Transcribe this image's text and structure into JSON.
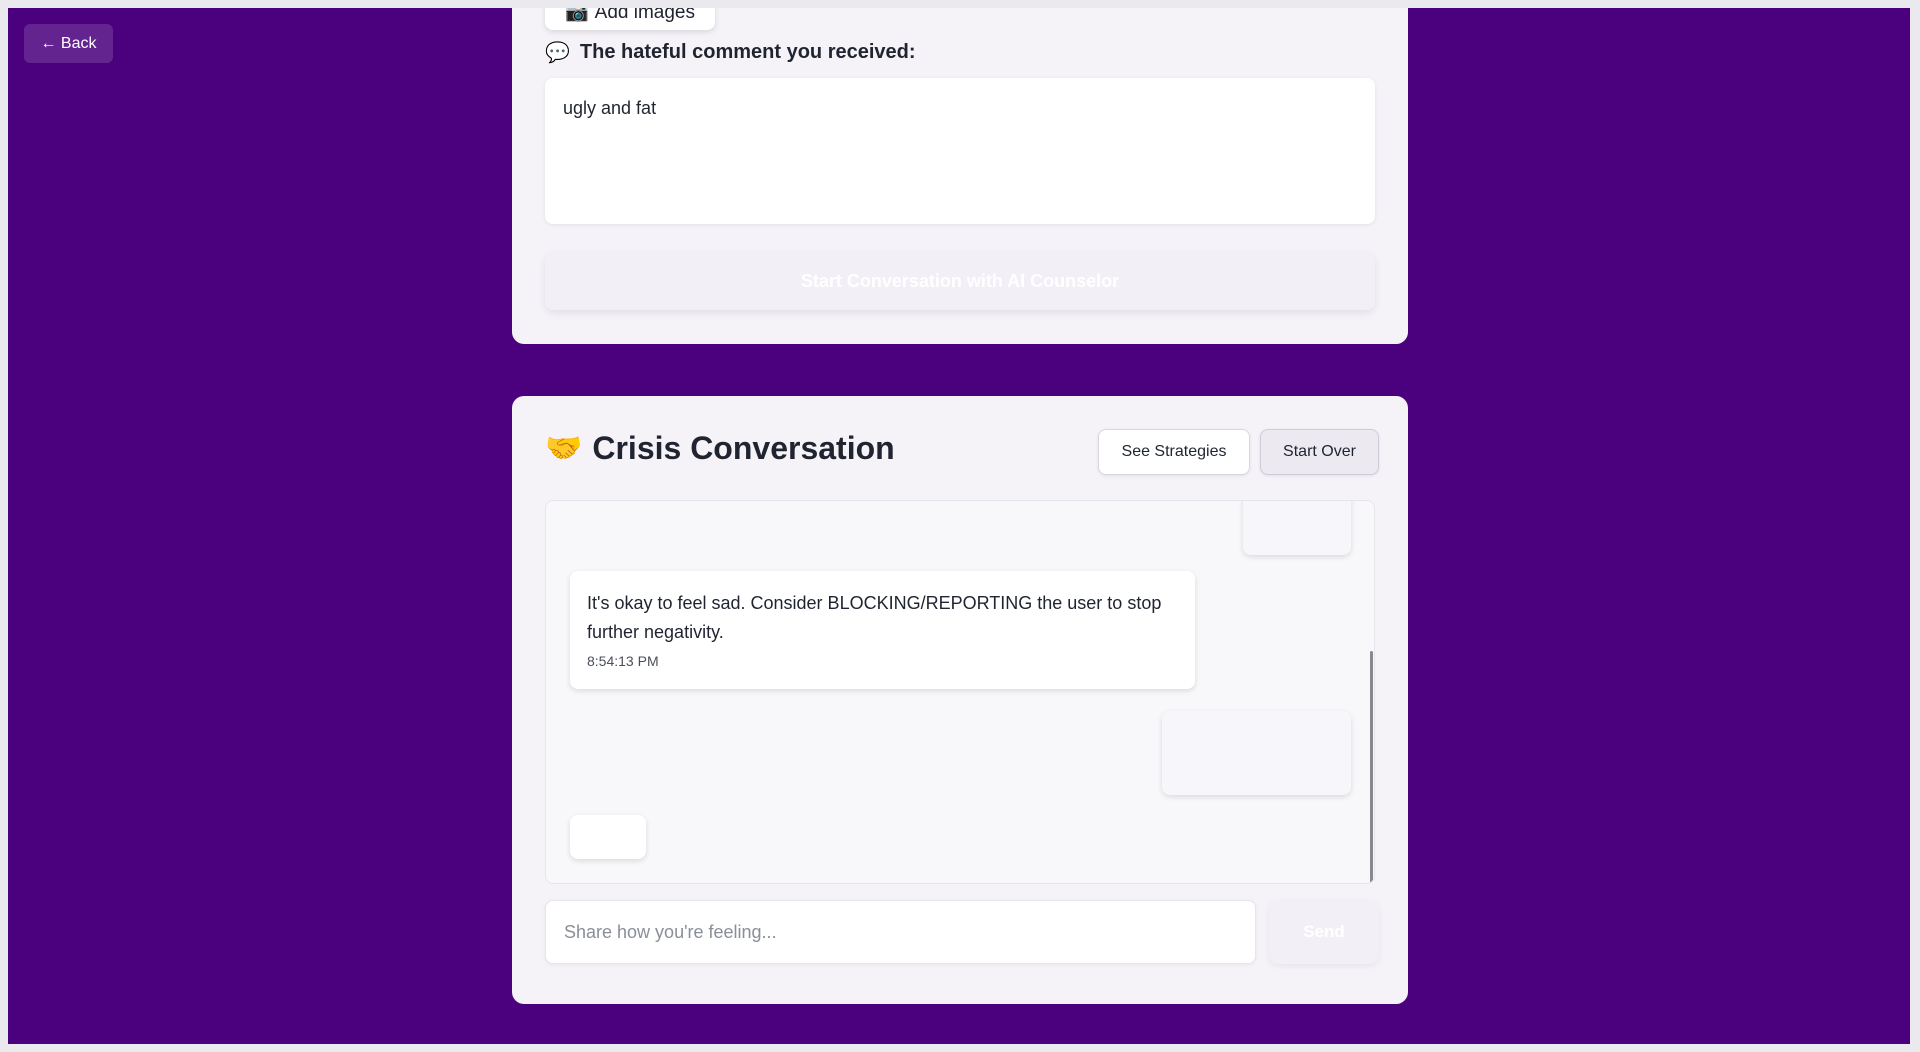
{
  "nav": {
    "back_label": "← Back"
  },
  "upload": {
    "add_images_icon": "📷",
    "add_images_label": "Add images"
  },
  "comment": {
    "icon": "💬",
    "label": "The hateful comment you received:",
    "value": "ugly and fat"
  },
  "start_button": {
    "label": "Start Conversation with AI Counselor"
  },
  "chat": {
    "title_icon": "🤝",
    "title": "Crisis Conversation",
    "see_strategies_label": "See Strategies",
    "start_over_label": "Start Over",
    "messages": [
      {
        "role": "bot",
        "text": "It's okay to feel sad. Consider BLOCKING/REPORTING the user to stop further negativity.",
        "time": "8:54:13 PM"
      }
    ],
    "input_placeholder": "Share how you're feeling...",
    "send_label": "Send"
  },
  "colors": {
    "page_background": "#4b007e",
    "card_background": "#f5f3f8",
    "text": "#1f2430"
  }
}
